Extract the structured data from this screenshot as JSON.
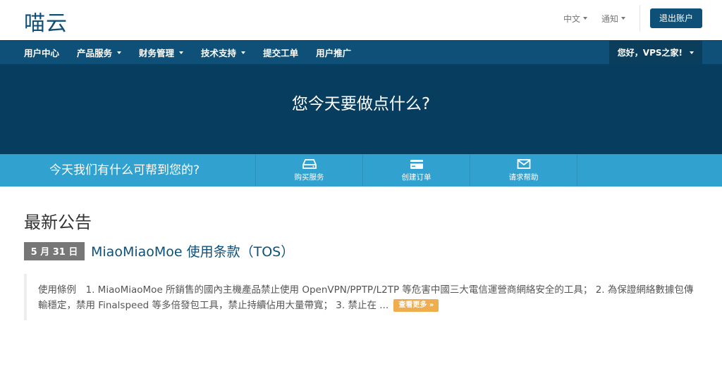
{
  "header": {
    "logo": "喵云",
    "language": "中文",
    "notifications": "通知",
    "logout": "退出账户"
  },
  "nav": {
    "items": [
      {
        "label": "用户中心",
        "dropdown": false
      },
      {
        "label": "产品服务",
        "dropdown": true
      },
      {
        "label": "财务管理",
        "dropdown": true
      },
      {
        "label": "技术支持",
        "dropdown": true
      },
      {
        "label": "提交工单",
        "dropdown": false
      },
      {
        "label": "用户推广",
        "dropdown": false
      }
    ],
    "user_greeting": "您好，VPS之家!"
  },
  "hero": {
    "title": "您今天要做点什么?"
  },
  "helpbar": {
    "text": "今天我们有什么可帮到您的?",
    "actions": [
      {
        "label": "购买服务",
        "icon": "server-icon"
      },
      {
        "label": "创建订单",
        "icon": "credit-card-icon"
      },
      {
        "label": "请求帮助",
        "icon": "envelope-icon"
      }
    ]
  },
  "announcements": {
    "section_title": "最新公告",
    "items": [
      {
        "date": "5 月 31 日",
        "title": "MiaoMiaoMoe 使用条款（TOS）",
        "excerpt": "使用條例　1. MiaoMiaoMoe 所銷售的國內主機產品禁止使用 OpenVPN/PPTP/L2TP 等危害中國三大電信運營商網絡安全的工具； 2. 為保證網絡數據包傳輸穩定，禁用 Finalspeed 等多倍發包工具，禁止持續佔用大量帶寬； 3. 禁止在 ...",
        "more_label": "查看更多 »"
      }
    ]
  },
  "colors": {
    "brand": "#0e5077",
    "hero_bg": "#073d5e",
    "helpbar_bg": "#31a1cf",
    "more_button": "#f0ad4e",
    "date_badge": "#777777"
  }
}
